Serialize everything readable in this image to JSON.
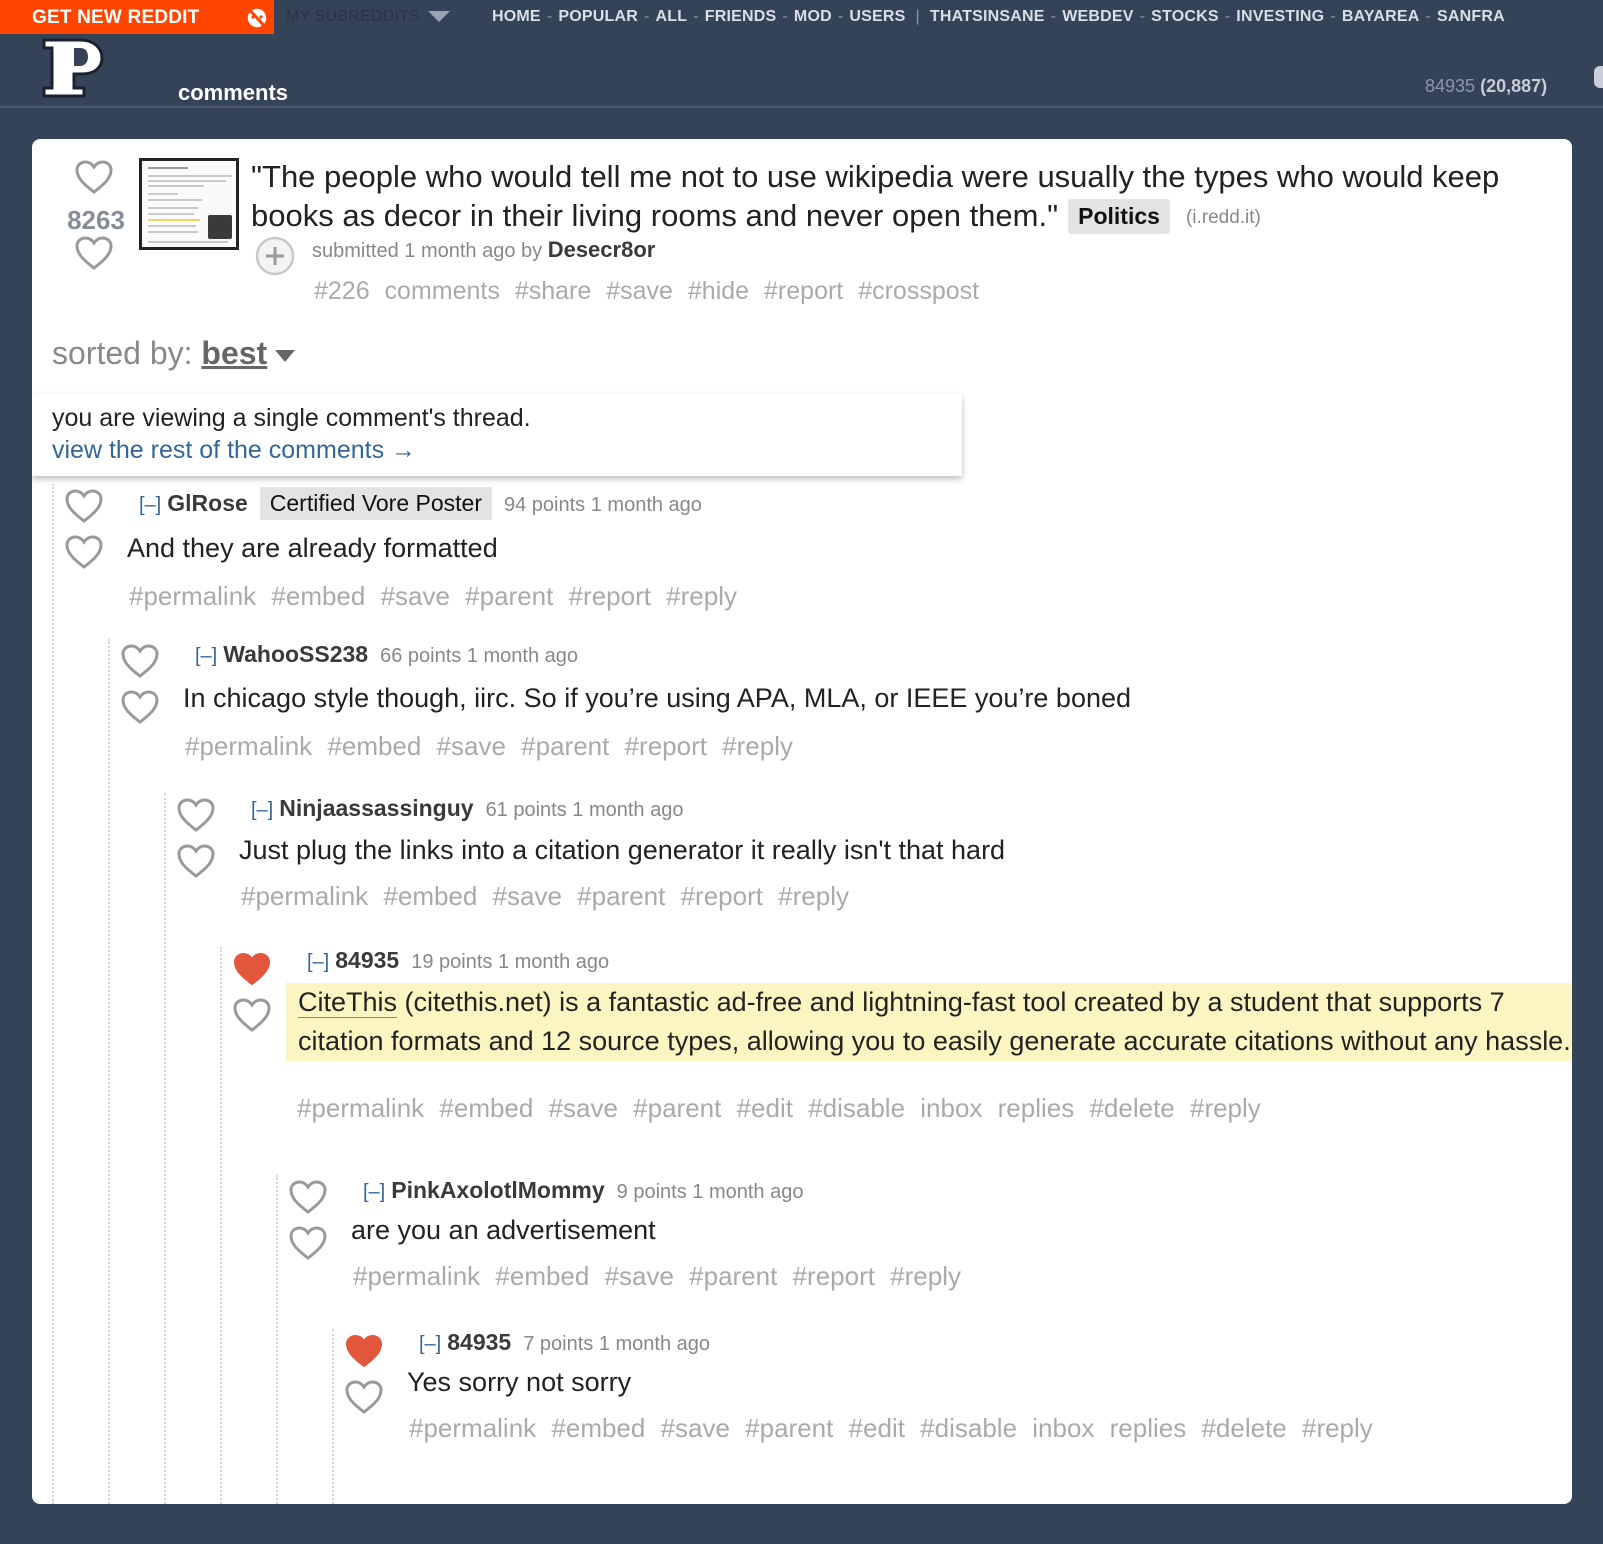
{
  "topbar": {
    "get_new_reddit": "GET NEW REDDIT",
    "my_subreddits": "MY SUBREDDITS",
    "nav": [
      "HOME",
      "POPULAR",
      "ALL",
      "FRIENDS",
      "MOD",
      "USERS"
    ],
    "subs": [
      "THATSINSANE",
      "WEBDEV",
      "STOCKS",
      "INVESTING",
      "BAYAREA",
      "SANFRA"
    ]
  },
  "header": {
    "page_title": "comments",
    "username": "84935",
    "karma": "(20,887)"
  },
  "post": {
    "score": "8263",
    "title": "\"The people who would tell me not to use wikipedia were usually the types who would keep books as decor in their living rooms and never open them.\"",
    "flair": "Politics",
    "domain": "(i.redd.it)",
    "submitted": "submitted 1 month ago by",
    "author": "Desecr8or",
    "buttons": [
      "#226 comments",
      "#share",
      "#save",
      "#hide",
      "#report",
      "#crosspost"
    ]
  },
  "sort": {
    "label": "sorted by:",
    "value": "best"
  },
  "single_thread": {
    "notice": "you are viewing a single comment's thread.",
    "link": "view the rest of the comments →"
  },
  "comments": [
    {
      "toggle": "[–]",
      "author": "GlRose",
      "flair": "Certified Vore Poster",
      "meta": "94 points 1 month ago",
      "body": "And they are already formatted",
      "buttons": "#permalink #embed #save #parent #report #reply"
    },
    {
      "toggle": "[–]",
      "author": "WahooSS238",
      "meta": "66 points 1 month ago",
      "body": "In chicago style though, iirc. So if you’re using APA, MLA, or IEEE you’re boned",
      "buttons": "#permalink #embed #save #parent #report #reply"
    },
    {
      "toggle": "[–]",
      "author": "Ninjaassassinguy",
      "meta": "61 points 1 month ago",
      "body": "Just plug the links into a citation generator it really isn't that hard",
      "buttons": "#permalink #embed #save #parent #report #reply"
    },
    {
      "toggle": "[–]",
      "author": "84935",
      "meta": "19 points 1 month ago",
      "body_link": "CiteThis",
      "body": " (citethis.net) is a fantastic ad-free and lightning-fast tool created by a student that supports 7 citation formats and 12 source types, allowing you to easily generate accurate citations without any hassle.",
      "buttons": "#permalink #embed #save #parent #edit #disable inbox replies #delete #reply"
    },
    {
      "toggle": "[–]",
      "author": "PinkAxolotlMommy",
      "meta": "9 points 1 month ago",
      "body": "are you an advertisement",
      "buttons": "#permalink #embed #save #parent #report #reply"
    },
    {
      "toggle": "[–]",
      "author": "84935",
      "meta": "7 points 1 month ago",
      "body": "Yes sorry not sorry",
      "buttons": "#permalink #embed #save #parent #edit #disable inbox replies #delete #reply"
    }
  ],
  "colors": {
    "background": "#354359",
    "orange": "#ff4500",
    "upvoted": "#e2563b",
    "highlight": "#fbf6c1",
    "link": "#336699"
  }
}
